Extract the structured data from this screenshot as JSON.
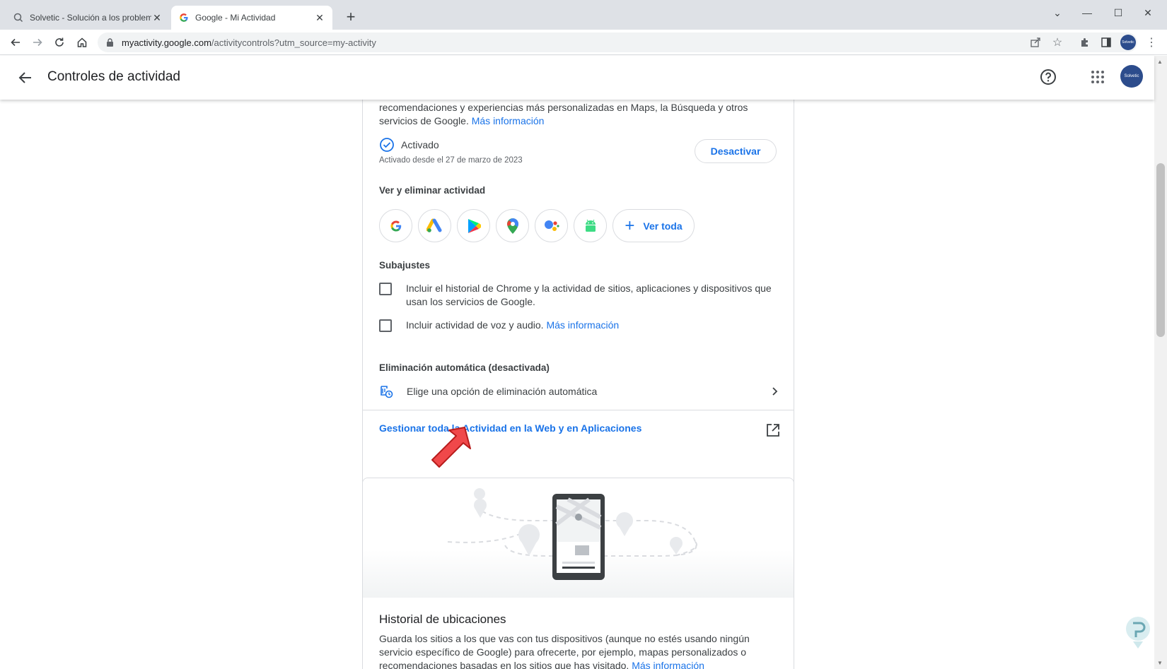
{
  "browser": {
    "tabs": [
      {
        "title": "Solvetic - Solución a los problem",
        "active": false
      },
      {
        "title": "Google - Mi Actividad",
        "active": true
      }
    ],
    "url_domain": "myactivity.google.com",
    "url_path": "/activitycontrols?utm_source=my-activity",
    "profile_label": "Solvetic"
  },
  "header": {
    "title": "Controles de actividad",
    "avatar_label": "Solvetic"
  },
  "web_activity": {
    "description": "recomendaciones y experiencias más personalizadas en Maps, la Búsqueda y otros servicios de Google.",
    "more_info": "Más información",
    "status": "Activado",
    "since": "Activado desde el 27 de marzo de 2023",
    "deactivate_label": "Desactivar",
    "view_delete_label": "Ver y eliminar actividad",
    "app_icons": [
      "google-icon",
      "google-ads-icon",
      "google-play-icon",
      "google-maps-icon",
      "google-assistant-icon",
      "android-icon"
    ],
    "see_all_label": "Ver toda",
    "subsettings_label": "Subajustes",
    "subsettings": [
      {
        "text": "Incluir el historial de Chrome y la actividad de sitios, aplicaciones y dispositivos que usan los servicios de Google.",
        "checked": false
      },
      {
        "text": "Incluir actividad de voz y audio.",
        "link": "Más información",
        "checked": false
      }
    ],
    "auto_delete_label": "Eliminación automática (desactivada)",
    "auto_delete_option": "Elige una opción de eliminación automática",
    "manage_link": "Gestionar toda la Actividad en la Web y en Aplicaciones"
  },
  "location_history": {
    "title": "Historial de ubicaciones",
    "description": "Guarda los sitios a los que vas con tus dispositivos (aunque no estés usando ningún servicio específico de Google) para ofrecerte, por ejemplo, mapas personalizados o recomendaciones basadas en los sitios que has visitado.",
    "more_info": "Más información"
  },
  "colors": {
    "accent": "#1a73e8",
    "arrow": "#f0484a"
  }
}
